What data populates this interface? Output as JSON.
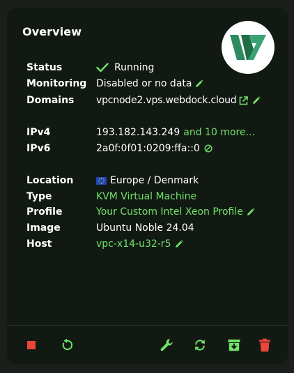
{
  "card": {
    "title": "Overview",
    "logo_icon": "webdock-logo"
  },
  "status": {
    "label": "Status",
    "value": "Running",
    "icon": "check-icon"
  },
  "monitoring": {
    "label": "Monitoring",
    "value": "Disabled or no data"
  },
  "domains": {
    "label": "Domains",
    "value": "vpcnode2.vps.webdock.cloud"
  },
  "ipv4": {
    "label": "IPv4",
    "value": "193.182.143.249",
    "more_link": "and 10 more..."
  },
  "ipv6": {
    "label": "IPv6",
    "value": "2a0f:0f01:0209:ffa::0"
  },
  "location": {
    "label": "Location",
    "value": "Europe / Denmark",
    "flag_icon": "eu-flag-icon"
  },
  "type": {
    "label": "Type",
    "value": "KVM Virtual Machine"
  },
  "profile": {
    "label": "Profile",
    "value": "Your Custom Intel Xeon Profile"
  },
  "image": {
    "label": "Image",
    "value": "Ubuntu Noble 24.04"
  },
  "host": {
    "label": "Host",
    "value": "vpc-x14-u32-r5"
  },
  "footer": {
    "actions": [
      "stop",
      "restart",
      "settings",
      "reinstall",
      "snapshot",
      "delete"
    ]
  },
  "colors": {
    "accent_green": "#6fe36a",
    "stop_red": "#e8473a",
    "delete_red": "#e8473a",
    "card_bg": "#121912",
    "page_bg": "#1a1f1b",
    "logo_green_dark": "#1f6e46",
    "logo_green_light": "#2e8b5f"
  }
}
